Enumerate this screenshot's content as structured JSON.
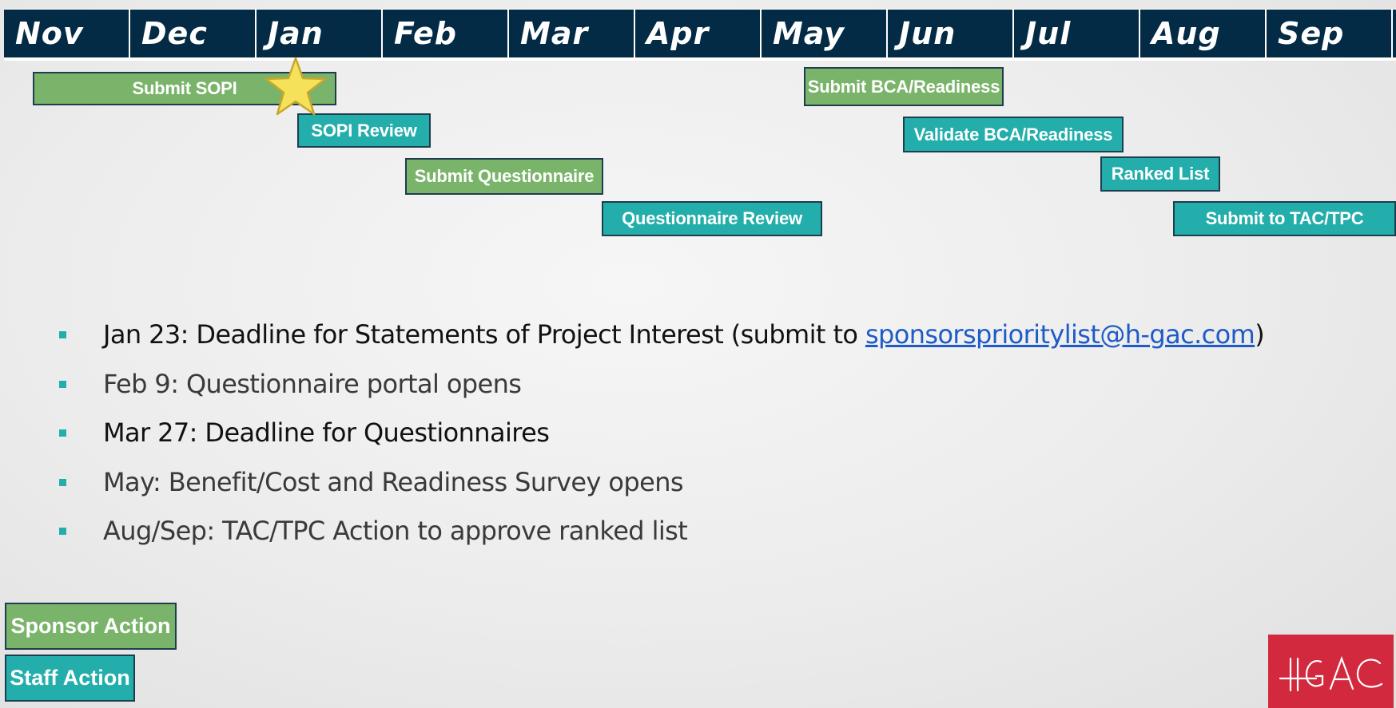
{
  "timeline": {
    "months": [
      "Nov",
      "Dec",
      "Jan",
      "Feb",
      "Mar",
      "Apr",
      "May",
      "Jun",
      "Jul",
      "Aug",
      "Sep"
    ],
    "tasks": [
      {
        "label": "Submit SOPI",
        "type": "sponsor"
      },
      {
        "label": "SOPI Review",
        "type": "staff"
      },
      {
        "label": "Submit Questionnaire",
        "type": "sponsor"
      },
      {
        "label": "Questionnaire Review",
        "type": "staff"
      },
      {
        "label": "Submit BCA/Readiness",
        "type": "sponsor"
      },
      {
        "label": "Validate BCA/Readiness",
        "type": "staff"
      },
      {
        "label": "Ranked List",
        "type": "staff"
      },
      {
        "label": "Submit to TAC/TPC",
        "type": "staff"
      }
    ]
  },
  "bullets": [
    {
      "prefix": "Jan 23: Deadline for Statements of Project Interest (submit to ",
      "link": "sponsorsprioritylist@h-gac.com",
      "suffix": ")"
    },
    {
      "text": "Feb 9: Questionnaire portal opens"
    },
    {
      "text": "Mar 27: Deadline for Questionnaires"
    },
    {
      "text": "May: Benefit/Cost and Readiness Survey opens"
    },
    {
      "text": "Aug/Sep: TAC/TPC Action to approve ranked list"
    }
  ],
  "legend": {
    "sponsor": "Sponsor Action",
    "staff": "Staff Action"
  },
  "colors": {
    "header": "#042b45",
    "sponsor": "#7ab46a",
    "staff": "#23aeab",
    "logo": "#d3293f",
    "star": "#f5e25a"
  },
  "icons": {
    "milestone": "star-icon",
    "logo": "hgac-logo"
  },
  "logo_text": "H-GAC"
}
